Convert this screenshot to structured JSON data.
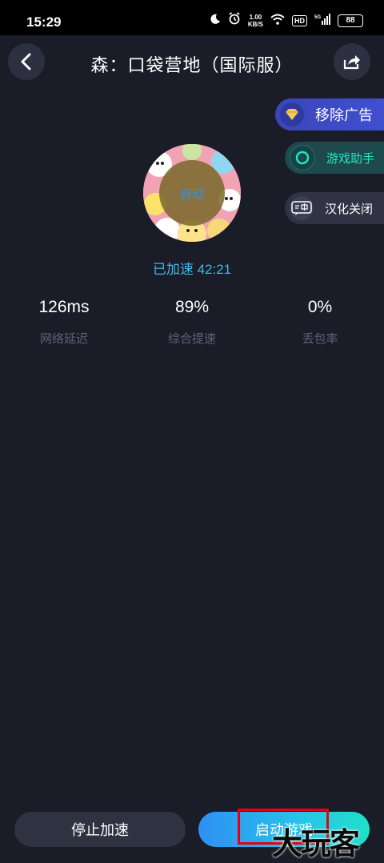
{
  "status_bar": {
    "time": "15:29",
    "net_speed_value": "1.00",
    "net_speed_unit": "KB/S",
    "hd_label": "HD",
    "signal_label": "5G",
    "battery": "88",
    "icons": [
      "moon-icon",
      "alarm-icon",
      "wifi-icon",
      "signal-icon",
      "battery-icon"
    ]
  },
  "header": {
    "title": "森：口袋营地（国际服）",
    "back_icon": "chevron-left-icon",
    "share_icon": "share-icon"
  },
  "side_buttons": {
    "remove_ads": "移除广告",
    "game_helper": "游戏助手",
    "localization_off": "汉化关闭"
  },
  "game": {
    "launch_overlay": "启动",
    "accel_status": "已加速 42:21"
  },
  "stats": [
    {
      "value": "126ms",
      "label": "网络延迟"
    },
    {
      "value": "89%",
      "label": "综合提速"
    },
    {
      "value": "0%",
      "label": "丢包率"
    }
  ],
  "bottom": {
    "stop_label": "停止加速",
    "launch_label": "启动游戏"
  },
  "watermark": "大玩客",
  "colors": {
    "background": "#1a1c27",
    "accent_cyan": "#3fb9e6",
    "helper_green": "#1de9c0",
    "highlight_red": "#e60012"
  }
}
